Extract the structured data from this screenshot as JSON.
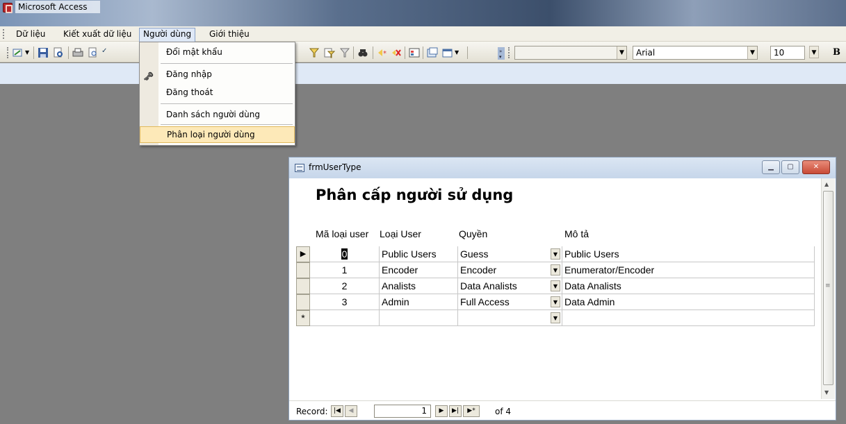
{
  "window": {
    "title": "Microsoft Access"
  },
  "menubar": {
    "items": [
      {
        "label": "Dữ liệu"
      },
      {
        "label": "Kiết xuất dữ liệu"
      },
      {
        "label": "Người dùng"
      },
      {
        "label": "Giới thiệu"
      }
    ],
    "active_index": 2
  },
  "dropdown": {
    "items": [
      {
        "label": "Đổi mật khẩu",
        "icon": ""
      },
      {
        "label": "Đăng nhập",
        "icon": "key-icon"
      },
      {
        "label": "Đăng thoát",
        "icon": ""
      },
      {
        "label": "Danh sách người dùng",
        "icon": ""
      },
      {
        "label": "Phân loại người dùng",
        "icon": "",
        "highlighted": true
      }
    ]
  },
  "toolbar": {
    "font_name": "Arial",
    "font_size": "10",
    "bold_label": "B",
    "style_combo_value": ""
  },
  "form": {
    "title": "frmUserType",
    "heading": "Phân cấp người  sử dụng",
    "columns": [
      "Mã loại user",
      "Loại User",
      "Quyền",
      "Mô tả"
    ],
    "rows": [
      {
        "id": "0",
        "type": "Public Users",
        "permission": "Guess",
        "description": "Public Users"
      },
      {
        "id": "1",
        "type": "Encoder",
        "permission": "Encoder",
        "description": "Enumerator/Encoder"
      },
      {
        "id": "2",
        "type": "Analists",
        "permission": "Data Analists",
        "description": "Data Analists"
      },
      {
        "id": "3",
        "type": "Admin",
        "permission": "Full Access",
        "description": "Data Admin"
      }
    ],
    "new_row_marker": "*",
    "current_row_marker": "▶",
    "navigation": {
      "label": "Record:",
      "current": "1",
      "of_text": "of 4"
    }
  },
  "colors": {
    "workspace": "#7f7f7f",
    "menu_highlight": "#fde9b8",
    "band": "#dfe9f6"
  }
}
